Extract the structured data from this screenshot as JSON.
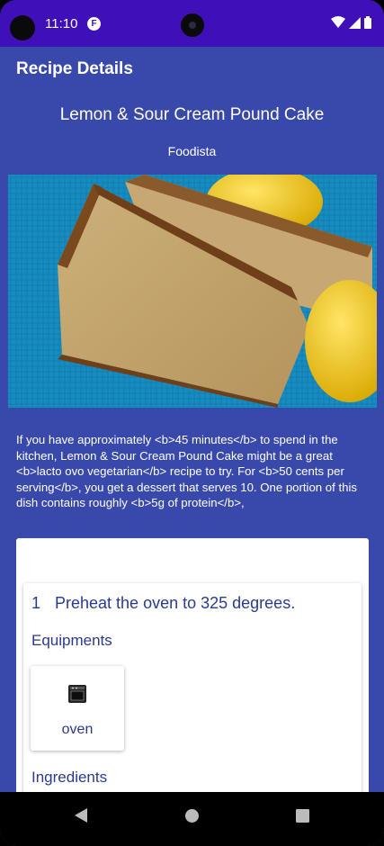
{
  "status_bar": {
    "time": "11:10",
    "notification_icon": "F",
    "icons": [
      "wifi-icon",
      "signal-icon",
      "battery-icon"
    ]
  },
  "app_bar": {
    "title": "Recipe Details"
  },
  "recipe": {
    "title": "Lemon & Sour Cream Pound Cake",
    "source": "Foodista",
    "image_alt": "lemon-pound-cake-photo",
    "summary": "If you have approximately <b>45 minutes</b> to spend in the kitchen, Lemon & Sour Cream Pound Cake might be a great <b>lacto ovo vegetarian</b> recipe to try. For <b>50 cents per serving</b>, you get a dessert that serves 10. One portion of this dish contains roughly <b>5g of protein</b>,"
  },
  "steps": [
    {
      "number": "1",
      "text": "Preheat the oven to 325 degrees.",
      "equipments_label": "Equipments",
      "equipments": [
        {
          "name": "oven",
          "icon": "oven-icon"
        }
      ],
      "ingredients_label": "Ingredients"
    }
  ],
  "nav_bar": {
    "buttons": [
      "back",
      "home",
      "recents"
    ]
  },
  "colors": {
    "status_bar": "#3f0fb8",
    "background": "#3949ab",
    "step_text": "#2a3a8f"
  }
}
